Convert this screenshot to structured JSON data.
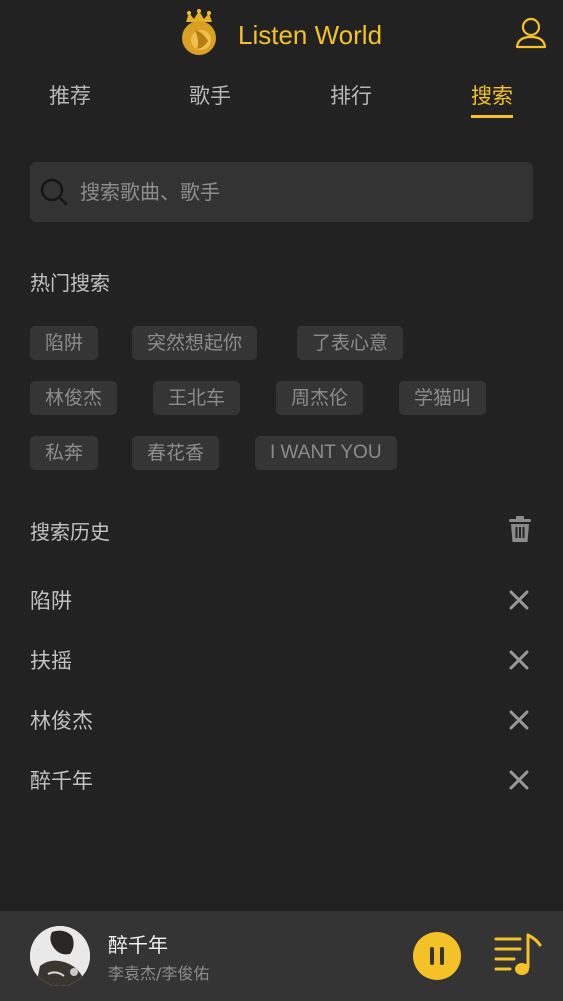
{
  "header": {
    "app_title": "Listen World"
  },
  "tabs": [
    {
      "label": "推荐"
    },
    {
      "label": "歌手"
    },
    {
      "label": "排行"
    },
    {
      "label": "搜索",
      "active": true
    }
  ],
  "search": {
    "placeholder": "搜索歌曲、歌手",
    "value": ""
  },
  "hot_search": {
    "title": "热门搜索",
    "tags": [
      "陷阱",
      "突然想起你",
      "了表心意",
      "林俊杰",
      "王北车",
      "周杰伦",
      "学猫叫",
      "私奔",
      "春花香",
      "I WANT YOU"
    ]
  },
  "history": {
    "title": "搜索历史",
    "items": [
      "陷阱",
      "扶摇",
      "林俊杰",
      "醉千年"
    ]
  },
  "player": {
    "song_title": "醉千年",
    "artist": "李袁杰/李俊佑",
    "state": "playing"
  },
  "colors": {
    "accent": "#f4c126",
    "background": "#222222",
    "tag_background": "#353535",
    "player_background": "#343434"
  },
  "icons": [
    "lion-crown-logo",
    "user-icon",
    "search-icon",
    "trash-icon",
    "close-icon",
    "pause-icon",
    "playlist-icon"
  ]
}
